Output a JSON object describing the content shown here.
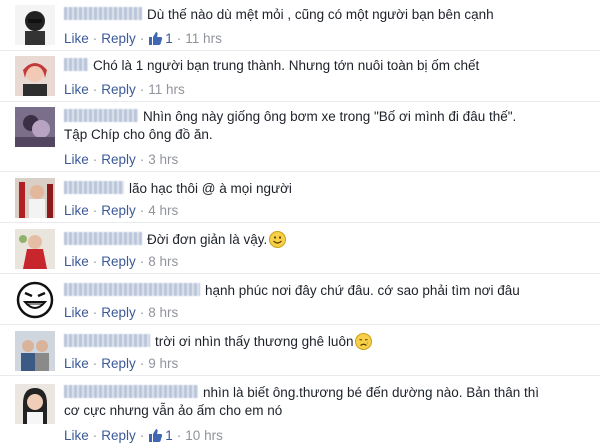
{
  "labels": {
    "like": "Like",
    "reply": "Reply",
    "dot": "·"
  },
  "comments": [
    {
      "name_hint": "",
      "text": "Dù thế nào dù mệt mỏi , cũng có một người bạn bên cạnh",
      "likes": "1",
      "time": "11 hrs"
    },
    {
      "name_hint": "Kye",
      "text": "Chó là 1 người bạn trung thành. Nhưng tớn nuôi toàn bị ốm chết",
      "likes": "",
      "time": "11 hrs"
    },
    {
      "name_hint": "",
      "text": "Nhìn ông này giống ông bơm xe trong \"Bố ơi mình đi đâu thế\".",
      "text2": "Tập Chíp cho ông đồ ăn.",
      "likes": "",
      "time": "3 hrs"
    },
    {
      "name_hint": "",
      "text": "lão hạc thôi @ à mọi người",
      "likes": "",
      "time": "4 hrs"
    },
    {
      "name_hint": "",
      "text": "Đời đơn giản là vậy.",
      "likes": "",
      "time": "8 hrs"
    },
    {
      "name_hint": "",
      "text": "hạnh phúc nơi đây chứ đâu. cớ sao phải tìm nơi đâu",
      "likes": "",
      "time": "8 hrs"
    },
    {
      "name_hint": "",
      "text": "trời ơi nhìn thấy thương ghê luôn",
      "likes": "",
      "time": "9 hrs"
    },
    {
      "name_hint": "",
      "text": "nhìn là biết ông.thương bé đến dường nào. Bản thân thì",
      "text2": "cơ cực nhưng vẫn ảo ấm cho em nó",
      "likes": "1",
      "time": "10 hrs"
    }
  ]
}
